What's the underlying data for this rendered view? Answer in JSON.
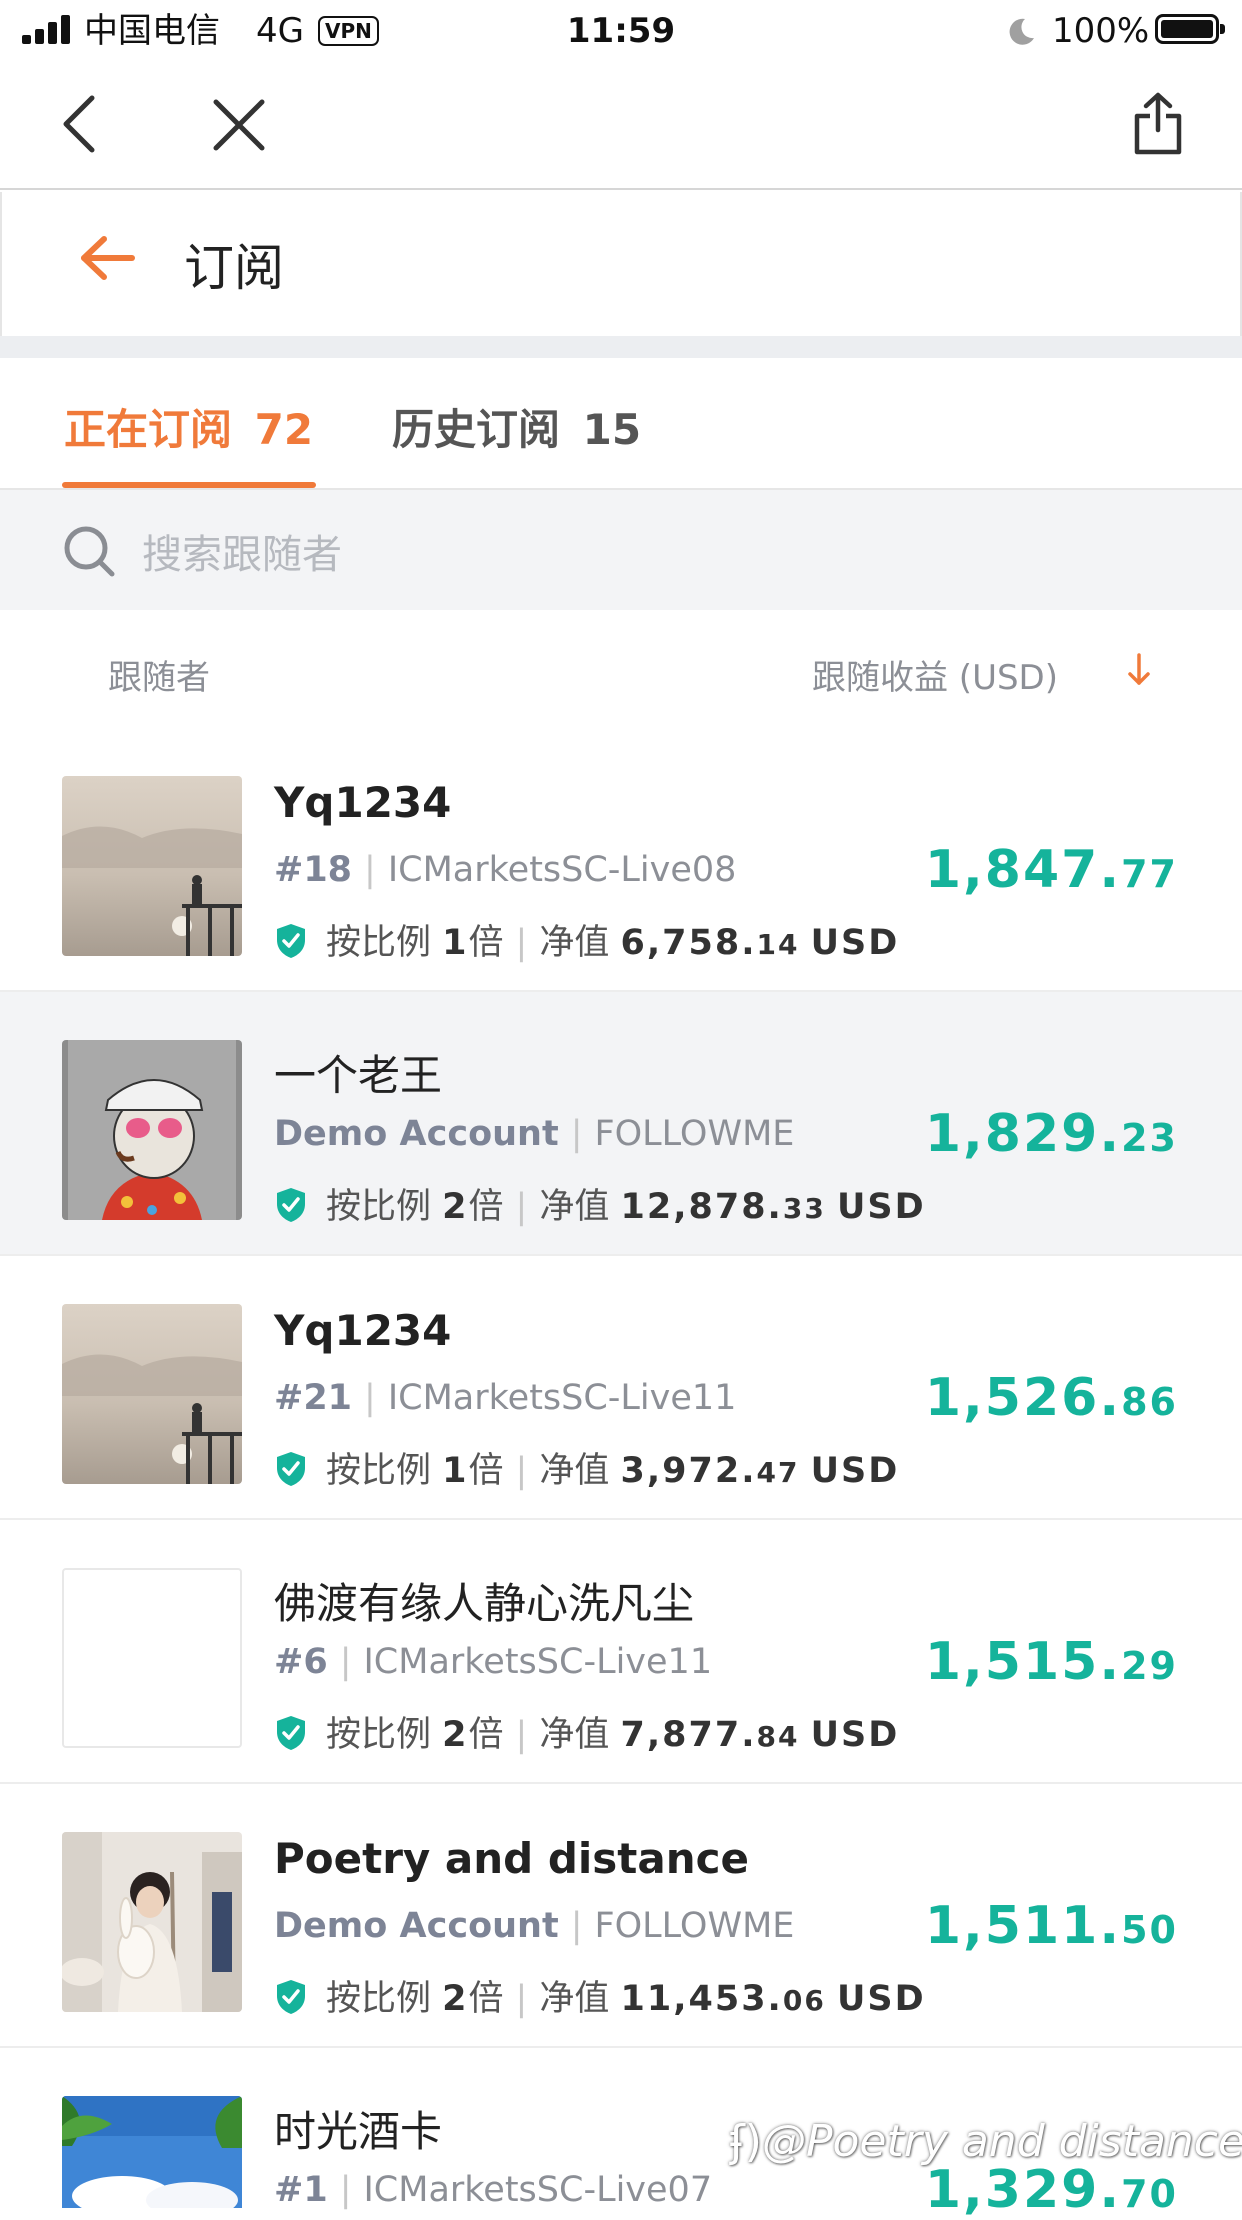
{
  "status_bar": {
    "carrier": "中国电信",
    "network": "4G",
    "vpn": "VPN",
    "time": "11:59",
    "battery": "100%"
  },
  "header": {
    "title": "订阅"
  },
  "tabs": [
    {
      "label": "正在订阅",
      "count": "72",
      "active": true
    },
    {
      "label": "历史订阅",
      "count": "15",
      "active": false
    }
  ],
  "search": {
    "placeholder": "搜索跟随者"
  },
  "list_header": {
    "follower": "跟随者",
    "profit": "跟随收益 (USD)"
  },
  "rows": [
    {
      "name": "Yq1234",
      "tag": "#18",
      "server": "ICMarketsSC-Live08",
      "ratio_prefix": "按比例",
      "ratio": "1",
      "ratio_unit": "倍",
      "equity_label": "净值",
      "equity_int": "6,758.",
      "equity_dec": "14",
      "currency": "USD",
      "profit_int": "1,847.",
      "profit_dec": "77"
    },
    {
      "name": "一个老王",
      "tag": "Demo Account",
      "server": "FOLLOWME",
      "ratio_prefix": "按比例",
      "ratio": "2",
      "ratio_unit": "倍",
      "equity_label": "净值",
      "equity_int": "12,878.",
      "equity_dec": "33",
      "currency": "USD",
      "profit_int": "1,829.",
      "profit_dec": "23"
    },
    {
      "name": "Yq1234",
      "tag": "#21",
      "server": "ICMarketsSC-Live11",
      "ratio_prefix": "按比例",
      "ratio": "1",
      "ratio_unit": "倍",
      "equity_label": "净值",
      "equity_int": "3,972.",
      "equity_dec": "47",
      "currency": "USD",
      "profit_int": "1,526.",
      "profit_dec": "86"
    },
    {
      "name": "佛渡有缘人静心洗凡尘",
      "tag": "#6",
      "server": "ICMarketsSC-Live11",
      "ratio_prefix": "按比例",
      "ratio": "2",
      "ratio_unit": "倍",
      "equity_label": "净值",
      "equity_int": "7,877.",
      "equity_dec": "84",
      "currency": "USD",
      "profit_int": "1,515.",
      "profit_dec": "29"
    },
    {
      "name": "Poetry and distance",
      "tag": "Demo Account",
      "server": "FOLLOWME",
      "ratio_prefix": "按比例",
      "ratio": "2",
      "ratio_unit": "倍",
      "equity_label": "净值",
      "equity_int": "11,453.",
      "equity_dec": "06",
      "currency": "USD",
      "profit_int": "1,511.",
      "profit_dec": "50"
    },
    {
      "name": "时光酒卡",
      "tag": "#1",
      "server": "ICMarketsSC-Live07",
      "profit_int": "1,329.",
      "profit_dec": "70"
    }
  ],
  "watermark": "@Poetry and distance",
  "colors": {
    "accent": "#f07a3a",
    "profit": "#15b39b",
    "verified": "#15b39b",
    "highlight_row": "#f3f4f6"
  }
}
